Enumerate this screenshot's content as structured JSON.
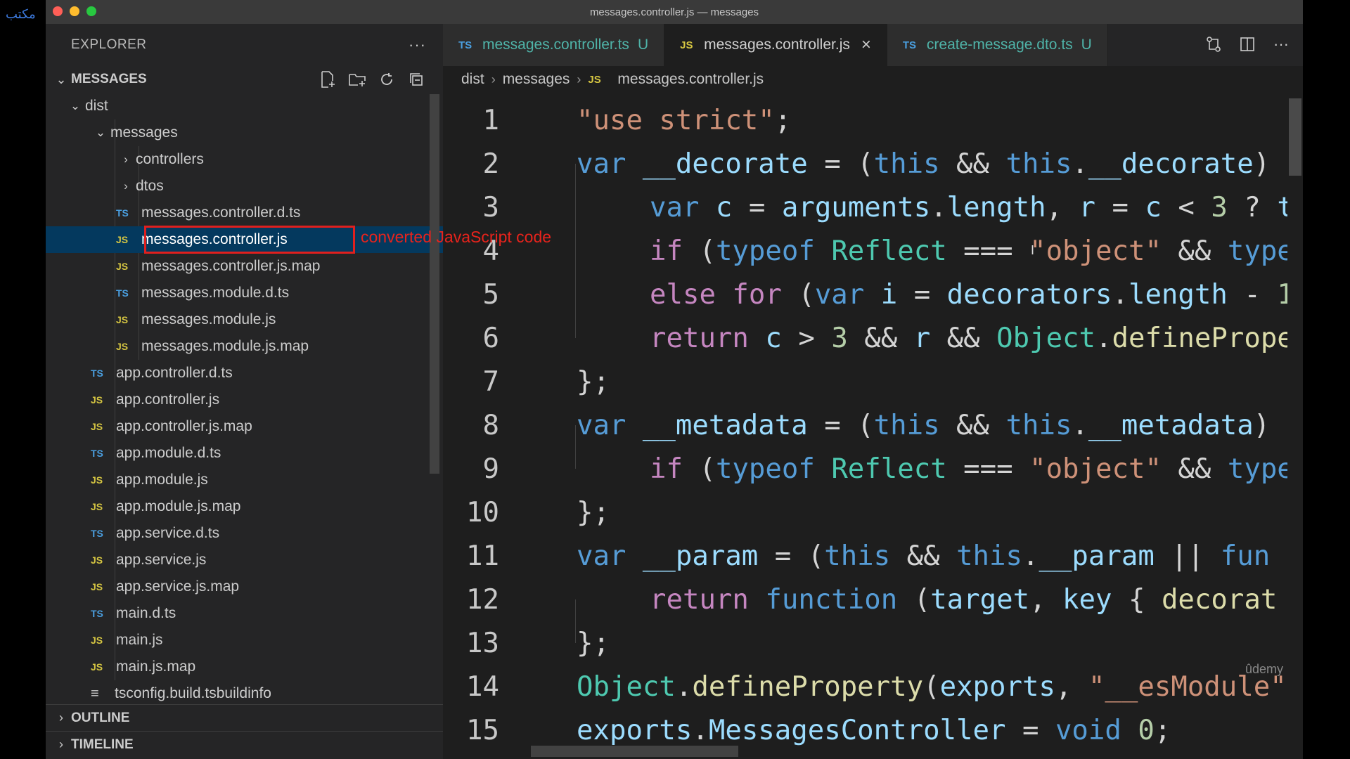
{
  "corner_mark": "مكتب",
  "window": {
    "title": "messages.controller.js — messages"
  },
  "sidebar": {
    "title": "EXPLORER",
    "section": "MESSAGES",
    "annotation": "converted JavaScript code",
    "tree": [
      {
        "label": "dist",
        "type": "folder",
        "open": true
      },
      {
        "label": "messages",
        "type": "folder",
        "open": true
      },
      {
        "label": "controllers",
        "type": "folder",
        "open": false
      },
      {
        "label": "dtos",
        "type": "folder",
        "open": false
      },
      {
        "label": "messages.controller.d.ts",
        "type": "TS"
      },
      {
        "label": "messages.controller.js",
        "type": "JS",
        "selected": true
      },
      {
        "label": "messages.controller.js.map",
        "type": "JS"
      },
      {
        "label": "messages.module.d.ts",
        "type": "TS"
      },
      {
        "label": "messages.module.js",
        "type": "JS"
      },
      {
        "label": "messages.module.js.map",
        "type": "JS"
      },
      {
        "label": "app.controller.d.ts",
        "type": "TS"
      },
      {
        "label": "app.controller.js",
        "type": "JS"
      },
      {
        "label": "app.controller.js.map",
        "type": "JS"
      },
      {
        "label": "app.module.d.ts",
        "type": "TS"
      },
      {
        "label": "app.module.js",
        "type": "JS"
      },
      {
        "label": "app.module.js.map",
        "type": "JS"
      },
      {
        "label": "app.service.d.ts",
        "type": "TS"
      },
      {
        "label": "app.service.js",
        "type": "JS"
      },
      {
        "label": "app.service.js.map",
        "type": "JS"
      },
      {
        "label": "main.d.ts",
        "type": "TS"
      },
      {
        "label": "main.js",
        "type": "JS"
      },
      {
        "label": "main.js.map",
        "type": "JS"
      },
      {
        "label": "tsconfig.build.tsbuildinfo",
        "type": "file"
      }
    ],
    "outline": "OUTLINE",
    "timeline": "TIMELINE"
  },
  "tabs": [
    {
      "badge": "TS",
      "label": "messages.controller.ts",
      "mod": "U"
    },
    {
      "badge": "JS",
      "label": "messages.controller.js",
      "close": "×"
    },
    {
      "badge": "TS",
      "label": "create-message.dto.ts",
      "mod": "U"
    }
  ],
  "breadcrumb": {
    "a": "dist",
    "b": "messages",
    "badge": "JS",
    "file": "messages.controller.js"
  },
  "watermark": "ûdemy",
  "code": [
    {
      "n": "1",
      "indent": 0,
      "t": [
        [
          "k-str",
          "\"use strict\""
        ],
        [
          "",
          "; "
        ]
      ]
    },
    {
      "n": "2",
      "indent": 0,
      "t": [
        [
          "k-blue",
          "var "
        ],
        [
          "k-var",
          "__decorate"
        ],
        [
          "",
          " = ("
        ],
        [
          "k-blue",
          "this"
        ],
        [
          "",
          " && "
        ],
        [
          "k-blue",
          "this"
        ],
        [
          "",
          "."
        ],
        [
          "k-var",
          "__decorate"
        ],
        [
          "",
          ")"
        ]
      ]
    },
    {
      "n": "3",
      "indent": 1,
      "t": [
        [
          "k-blue",
          "var "
        ],
        [
          "k-var",
          "c"
        ],
        [
          "",
          " = "
        ],
        [
          "k-var",
          "arguments"
        ],
        [
          "",
          "."
        ],
        [
          "k-var",
          "length"
        ],
        [
          "",
          ", "
        ],
        [
          "k-var",
          "r"
        ],
        [
          "",
          " = "
        ],
        [
          "k-var",
          "c"
        ],
        [
          "",
          " < "
        ],
        [
          "k-num",
          "3"
        ],
        [
          "",
          " ? "
        ],
        [
          "k-var",
          "t"
        ]
      ]
    },
    {
      "n": "4",
      "indent": 1,
      "t": [
        [
          "k-purple",
          "if "
        ],
        [
          "",
          "("
        ],
        [
          "k-blue",
          "typeof "
        ],
        [
          "k-type",
          "Reflect"
        ],
        [
          "",
          " === "
        ],
        [
          "k-str",
          "\"object\""
        ],
        [
          "",
          " && "
        ],
        [
          "k-blue",
          "type"
        ]
      ]
    },
    {
      "n": "5",
      "indent": 1,
      "t": [
        [
          "k-purple",
          "else for "
        ],
        [
          "",
          "("
        ],
        [
          "k-blue",
          "var "
        ],
        [
          "k-var",
          "i"
        ],
        [
          "",
          " = "
        ],
        [
          "k-var",
          "decorators"
        ],
        [
          "",
          "."
        ],
        [
          "k-var",
          "length"
        ],
        [
          "",
          " - "
        ],
        [
          "k-num",
          "1"
        ]
      ]
    },
    {
      "n": "6",
      "indent": 1,
      "t": [
        [
          "k-purple",
          "return "
        ],
        [
          "k-var",
          "c"
        ],
        [
          "",
          " > "
        ],
        [
          "k-num",
          "3"
        ],
        [
          "",
          " && "
        ],
        [
          "k-var",
          "r"
        ],
        [
          "",
          " && "
        ],
        [
          "k-type",
          "Object"
        ],
        [
          "",
          "."
        ],
        [
          "k-fn",
          "defineProperty"
        ]
      ]
    },
    {
      "n": "7",
      "indent": 0,
      "t": [
        [
          "",
          "};"
        ]
      ]
    },
    {
      "n": "8",
      "indent": 0,
      "t": [
        [
          "k-blue",
          "var "
        ],
        [
          "k-var",
          "__metadata"
        ],
        [
          "",
          " = ("
        ],
        [
          "k-blue",
          "this"
        ],
        [
          "",
          " && "
        ],
        [
          "k-blue",
          "this"
        ],
        [
          "",
          "."
        ],
        [
          "k-var",
          "__metadata"
        ],
        [
          "",
          ")"
        ]
      ]
    },
    {
      "n": "9",
      "indent": 1,
      "t": [
        [
          "k-purple",
          "if "
        ],
        [
          "",
          "("
        ],
        [
          "k-blue",
          "typeof "
        ],
        [
          "k-type",
          "Reflect"
        ],
        [
          "",
          " === "
        ],
        [
          "k-str",
          "\"object\""
        ],
        [
          "",
          " && "
        ],
        [
          "k-blue",
          "type"
        ]
      ]
    },
    {
      "n": "10",
      "indent": 0,
      "t": [
        [
          "",
          "};"
        ]
      ]
    },
    {
      "n": "11",
      "indent": 0,
      "t": [
        [
          "k-blue",
          "var "
        ],
        [
          "k-var",
          "__param"
        ],
        [
          "",
          " = ("
        ],
        [
          "k-blue",
          "this"
        ],
        [
          "",
          " && "
        ],
        [
          "k-blue",
          "this"
        ],
        [
          "",
          "."
        ],
        [
          "k-var",
          "__param"
        ],
        [
          "",
          " || "
        ],
        [
          "k-blue",
          "fun"
        ]
      ]
    },
    {
      "n": "12",
      "indent": 1,
      "t": [
        [
          "k-purple",
          "return "
        ],
        [
          "k-blue",
          "function "
        ],
        [
          "",
          "("
        ],
        [
          "k-var",
          "target"
        ],
        [
          "",
          ", "
        ],
        [
          "k-var",
          "key"
        ],
        [
          "",
          " { "
        ],
        [
          "k-fn",
          "decorat"
        ]
      ]
    },
    {
      "n": "13",
      "indent": 0,
      "t": [
        [
          "",
          "};"
        ]
      ]
    },
    {
      "n": "14",
      "indent": 0,
      "t": [
        [
          "k-type",
          "Object"
        ],
        [
          "",
          "."
        ],
        [
          "k-fn",
          "defineProperty"
        ],
        [
          "",
          "("
        ],
        [
          "k-var",
          "exports"
        ],
        [
          "",
          ", "
        ],
        [
          "k-str",
          "\"__esModule\""
        ]
      ]
    },
    {
      "n": "15",
      "indent": 0,
      "t": [
        [
          "k-var",
          "exports"
        ],
        [
          "",
          "."
        ],
        [
          "k-var",
          "MessagesController"
        ],
        [
          "",
          " = "
        ],
        [
          "k-blue",
          "void "
        ],
        [
          "k-num",
          "0"
        ],
        [
          "",
          ";"
        ]
      ]
    }
  ]
}
